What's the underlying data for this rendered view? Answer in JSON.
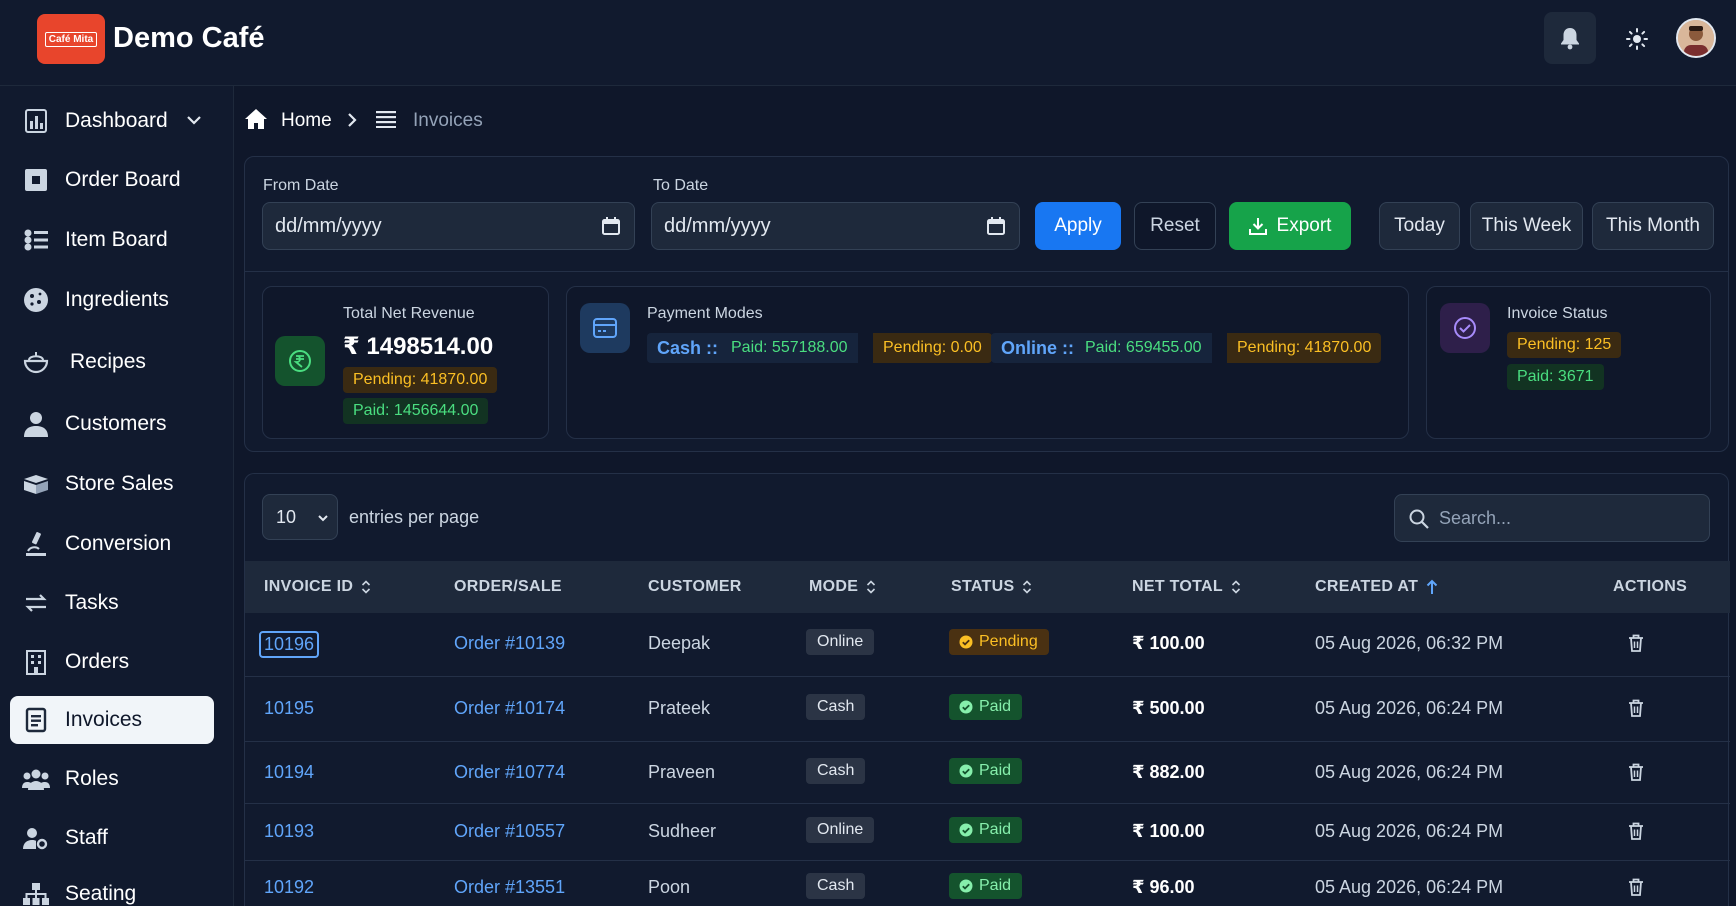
{
  "brand": {
    "logo_text": "Café Mita",
    "name": "Demo Café"
  },
  "header": {
    "bell_icon": "bell-icon",
    "theme_icon": "sun-icon",
    "avatar": "user-avatar"
  },
  "sidebar": {
    "items": [
      {
        "label": "Dashboard",
        "icon": "chart-icon",
        "has_chevron": true
      },
      {
        "label": "Order Board",
        "icon": "board-icon"
      },
      {
        "label": "Item Board",
        "icon": "list-check-icon"
      },
      {
        "label": "Ingredients",
        "icon": "cookie-icon"
      },
      {
        "label": "Recipes",
        "icon": "bowl-icon"
      },
      {
        "label": "Customers",
        "icon": "person-icon"
      },
      {
        "label": "Store Sales",
        "icon": "box-icon"
      },
      {
        "label": "Conversion",
        "icon": "microscope-icon"
      },
      {
        "label": "Tasks",
        "icon": "arrows-icon"
      },
      {
        "label": "Orders",
        "icon": "building-icon"
      },
      {
        "label": "Invoices",
        "icon": "document-icon",
        "active": true
      },
      {
        "label": "Roles",
        "icon": "group-icon"
      },
      {
        "label": "Staff",
        "icon": "user-gear-icon"
      },
      {
        "label": "Seating",
        "icon": "network-icon"
      }
    ]
  },
  "breadcrumb": {
    "home": "Home",
    "current": "Invoices"
  },
  "filters": {
    "from_label": "From Date",
    "from_value": "dd/mm/yyyy",
    "to_label": "To Date",
    "to_value": "dd/mm/yyyy",
    "apply": "Apply",
    "reset": "Reset",
    "export": "Export",
    "today": "Today",
    "this_week": "This Week",
    "this_month": "This Month"
  },
  "stats": {
    "revenue": {
      "title": "Total Net Revenue",
      "amount": "₹ 1498514.00",
      "pending": "Pending: 41870.00",
      "paid": "Paid: 1456644.00"
    },
    "payment_modes": {
      "title": "Payment Modes",
      "cash_label": "Cash ::",
      "cash_paid": "Paid: 557188.00",
      "cash_pending": "Pending: 0.00",
      "online_label": "Online ::",
      "online_paid": "Paid: 659455.00",
      "online_pending": "Pending: 41870.00"
    },
    "invoice_status": {
      "title": "Invoice Status",
      "pending": "Pending: 125",
      "paid": "Paid: 3671"
    }
  },
  "table": {
    "entries_value": "10",
    "entries_label": "entries per page",
    "search_placeholder": "Search...",
    "columns": [
      "INVOICE ID",
      "ORDER/SALE",
      "CUSTOMER",
      "MODE",
      "STATUS",
      "NET TOTAL",
      "CREATED AT",
      "ACTIONS"
    ],
    "rows": [
      {
        "id": "10196",
        "order": "Order #10139",
        "customer": "Deepak",
        "mode": "Online",
        "status": "Pending",
        "total": "₹ 100.00",
        "created": "05 Aug 2026, 06:32 PM"
      },
      {
        "id": "10195",
        "order": "Order #10174",
        "customer": "Prateek",
        "mode": "Cash",
        "status": "Paid",
        "total": "₹ 500.00",
        "created": "05 Aug 2026, 06:24 PM"
      },
      {
        "id": "10194",
        "order": "Order #10774",
        "customer": "Praveen",
        "mode": "Cash",
        "status": "Paid",
        "total": "₹ 882.00",
        "created": "05 Aug 2026, 06:24 PM"
      },
      {
        "id": "10193",
        "order": "Order #10557",
        "customer": "Sudheer",
        "mode": "Online",
        "status": "Paid",
        "total": "₹ 100.00",
        "created": "05 Aug 2026, 06:24 PM"
      },
      {
        "id": "10192",
        "order": "Order #13551",
        "customer": "Poon",
        "mode": "Cash",
        "status": "Paid",
        "total": "₹ 96.00",
        "created": "05 Aug 2026, 06:24 PM"
      }
    ]
  },
  "colors": {
    "accent": "#1877f2",
    "export": "#16a34a",
    "pending": "#fbbf24",
    "paid": "#4ade80",
    "link": "#60a5fa"
  }
}
